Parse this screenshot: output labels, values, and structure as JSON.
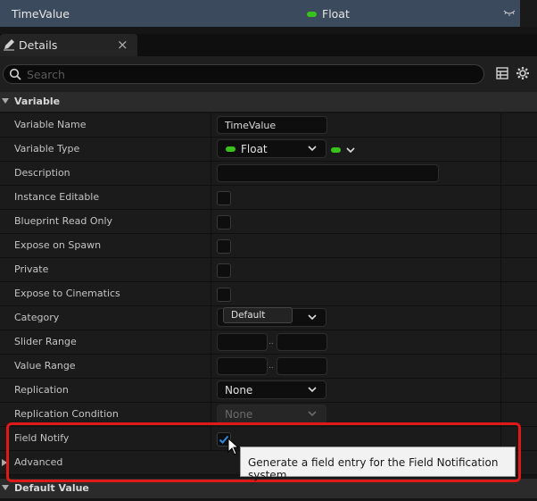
{
  "variable_row": {
    "name": "TimeValue",
    "type": "Float"
  },
  "tab": {
    "label": "Details"
  },
  "search": {
    "placeholder": "Search"
  },
  "categories": {
    "variable": "Variable",
    "default_value": "Default Value"
  },
  "properties": {
    "variable_name": {
      "label": "Variable Name",
      "value": "TimeValue"
    },
    "variable_type": {
      "label": "Variable Type",
      "value": "Float"
    },
    "description": {
      "label": "Description",
      "value": ""
    },
    "instance_editable": {
      "label": "Instance Editable",
      "checked": false
    },
    "blueprint_read_only": {
      "label": "Blueprint Read Only",
      "checked": false
    },
    "expose_on_spawn": {
      "label": "Expose on Spawn",
      "checked": false
    },
    "private": {
      "label": "Private",
      "checked": false
    },
    "expose_to_cinematics": {
      "label": "Expose to Cinematics",
      "checked": false
    },
    "category": {
      "label": "Category",
      "value": "Default"
    },
    "slider_range": {
      "label": "Slider Range",
      "min": "",
      "max": ""
    },
    "value_range": {
      "label": "Value Range",
      "min": "",
      "max": ""
    },
    "replication": {
      "label": "Replication",
      "value": "None"
    },
    "replication_condition": {
      "label": "Replication Condition",
      "value": "None"
    },
    "field_notify": {
      "label": "Field Notify",
      "checked": true
    },
    "advanced": {
      "label": "Advanced"
    }
  },
  "range_separator": "..",
  "tooltip": {
    "text": "Generate a field entry for the Field Notification system."
  },
  "colors": {
    "float_pin": "#38c21b",
    "highlight": "#e01818",
    "check_accent": "#2f8ae0"
  }
}
